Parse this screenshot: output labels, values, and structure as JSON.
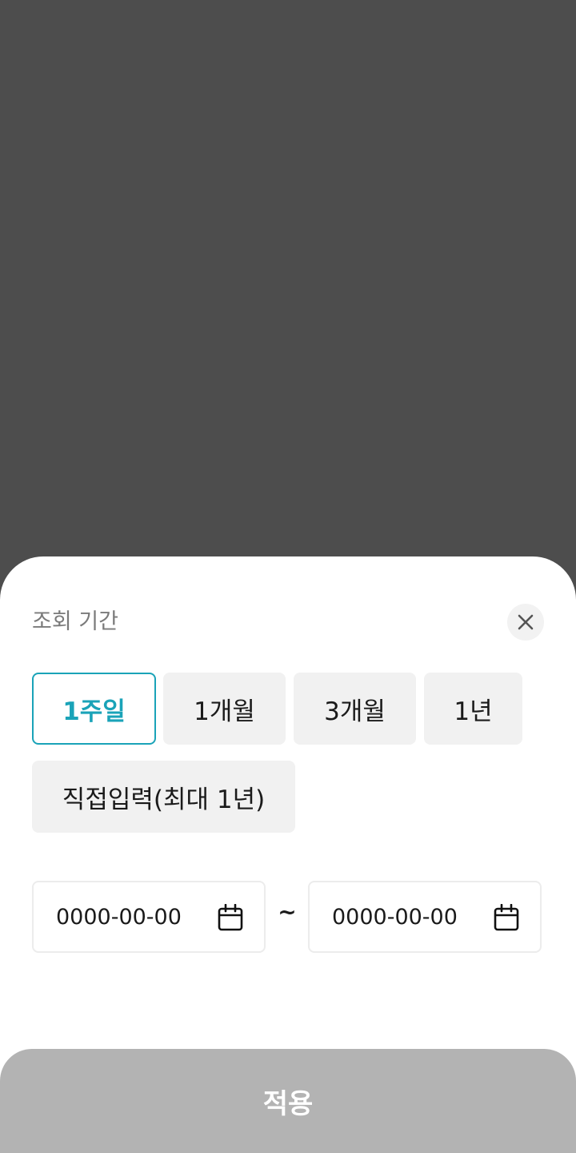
{
  "sheet": {
    "title": "조회 기간",
    "close_icon": "close-icon"
  },
  "periods": {
    "selected": "1주일",
    "options": [
      "1주일",
      "1개월",
      "3개월",
      "1년",
      "직접입력(최대 1년)"
    ]
  },
  "date_range": {
    "start_placeholder": "0000-00-00",
    "end_placeholder": "0000-00-00",
    "separator": "~",
    "icon": "calendar-icon"
  },
  "apply_label": "적용",
  "colors": {
    "accent": "#1aa3b8",
    "backdrop": "#4d4d4d",
    "apply_disabled": "#b3b3b3",
    "chip_bg": "#f1f1f1"
  }
}
